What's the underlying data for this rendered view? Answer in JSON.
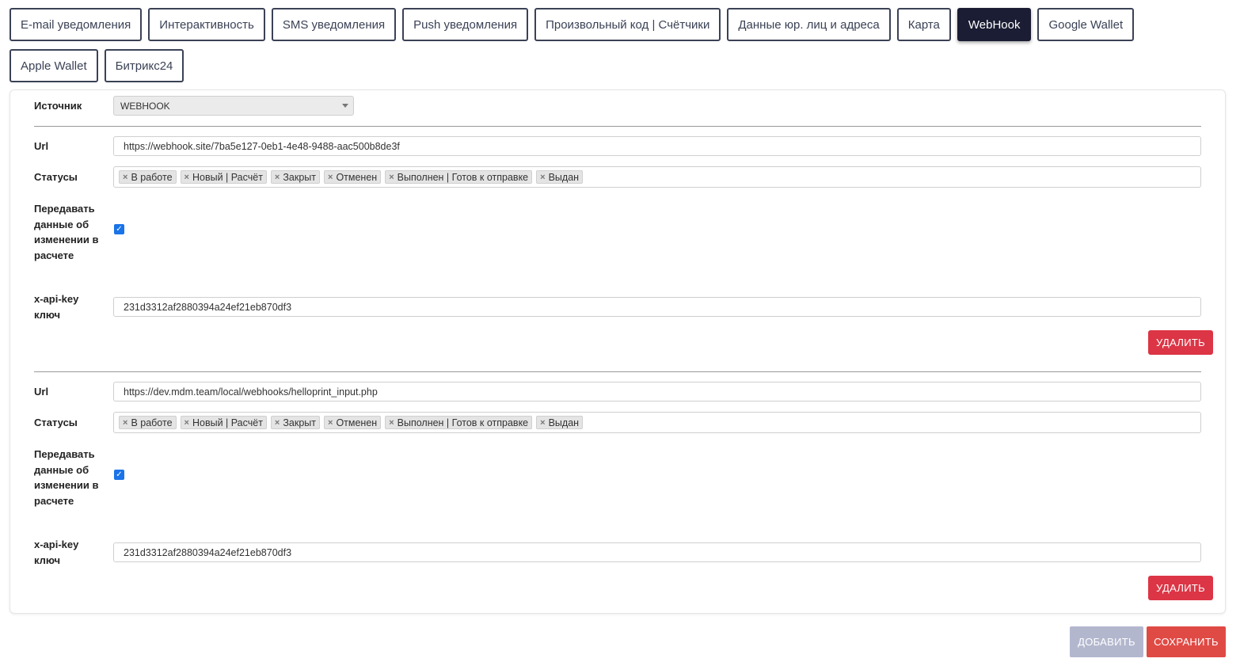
{
  "tabs": {
    "row1": [
      {
        "label": "E-mail уведомления",
        "active": false
      },
      {
        "label": "Интерактивность",
        "active": false
      },
      {
        "label": "SMS уведомления",
        "active": false
      },
      {
        "label": "Push уведомления",
        "active": false
      },
      {
        "label": "Произвольный код | Счётчики",
        "active": false
      },
      {
        "label": "Данные юр. лиц и адреса",
        "active": false
      },
      {
        "label": "Карта",
        "active": false
      },
      {
        "label": "WebHook",
        "active": true
      },
      {
        "label": "Google Wallet",
        "active": false
      }
    ],
    "row2": [
      {
        "label": "Apple Wallet",
        "active": false
      },
      {
        "label": "Битрикс24",
        "active": false
      }
    ]
  },
  "source": {
    "label": "Источник",
    "value": "WEBHOOK"
  },
  "field_labels": {
    "url": "Url",
    "statuses": "Статусы",
    "transfer_line1": "Передавать",
    "transfer_line2": "данные об",
    "transfer_line3": "изменении в",
    "transfer_line4": "расчете",
    "apikey_line1": "x-api-key",
    "apikey_line2": "ключ"
  },
  "webhooks": [
    {
      "url": "https://webhook.site/7ba5e127-0eb1-4e48-9488-aac500b8de3f",
      "statuses": [
        "В работе",
        "Новый | Расчёт",
        "Закрыт",
        "Отменен",
        "Выполнен | Готов к отправке",
        "Выдан"
      ],
      "transfer_checked": true,
      "api_key": "231d3312af2880394a24ef21eb870df3",
      "delete_label": "УДАЛИТЬ"
    },
    {
      "url": "https://dev.mdm.team/local/webhooks/helloprint_input.php",
      "statuses": [
        "В работе",
        "Новый | Расчёт",
        "Закрыт",
        "Отменен",
        "Выполнен | Готов к отправке",
        "Выдан"
      ],
      "transfer_checked": true,
      "api_key": "231d3312af2880394a24ef21eb870df3",
      "delete_label": "УДАЛИТЬ"
    }
  ],
  "actions": {
    "add_label": "ДОБАВИТЬ",
    "save_label": "СОХРАНИТЬ"
  },
  "colors": {
    "active_tab": "#1a1d33",
    "delete": "#dc3545",
    "save": "#e04a45",
    "add": "#b3b7ce",
    "checkbox": "#1a73e8"
  }
}
